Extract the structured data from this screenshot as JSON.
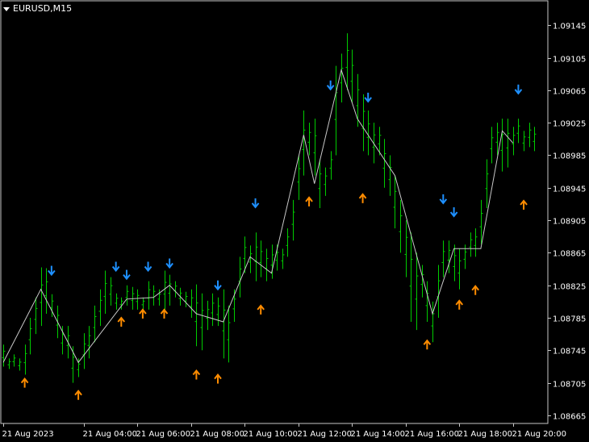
{
  "window": {
    "title": "EURUSD,M15"
  },
  "colors": {
    "background": "#000000",
    "frame": "#c8c8c8",
    "axis_text": "#ffffff",
    "bars": "#00cc00",
    "line": "#c8c8c8",
    "down_arrow": "#1e90ff",
    "up_arrow": "#ff8c00"
  },
  "icons": {
    "sell_signal": "down-arrow-icon",
    "buy_signal": "up-arrow-icon",
    "menu": "triangle-down-icon"
  },
  "chart_data": {
    "type": "line",
    "chart_kind": "ohlc-bars",
    "symbol": "EURUSD",
    "timeframe": "M15",
    "ylim": [
      1.08655,
      1.09175
    ],
    "y_ticks": [
      1.09145,
      1.09105,
      1.09065,
      1.09025,
      1.08985,
      1.08945,
      1.08905,
      1.08865,
      1.08825,
      1.08785,
      1.08745,
      1.08705,
      1.08665
    ],
    "x_ticks": [
      "21 Aug 2023",
      "21 Aug 04:00",
      "21 Aug 06:00",
      "21 Aug 08:00",
      "21 Aug 10:00",
      "21 Aug 12:00",
      "21 Aug 14:00",
      "21 Aug 16:00",
      "21 Aug 18:00",
      "21 Aug 20:00"
    ],
    "x_tick_index": [
      0,
      15,
      25,
      35,
      45,
      55,
      65,
      75,
      85,
      95
    ],
    "bar_count": 100,
    "bars": [
      {
        "h": 1.08752,
        "l": 1.08725
      },
      {
        "h": 1.08735,
        "l": 1.08722
      },
      {
        "h": 1.0874,
        "l": 1.08725
      },
      {
        "h": 1.08735,
        "l": 1.0872
      },
      {
        "h": 1.08752,
        "l": 1.08715
      },
      {
        "h": 1.08785,
        "l": 1.0874
      },
      {
        "h": 1.0881,
        "l": 1.08765
      },
      {
        "h": 1.08847,
        "l": 1.08775
      },
      {
        "h": 1.08846,
        "l": 1.0879
      },
      {
        "h": 1.08814,
        "l": 1.08786
      },
      {
        "h": 1.088,
        "l": 1.0876
      },
      {
        "h": 1.08775,
        "l": 1.0874
      },
      {
        "h": 1.08775,
        "l": 1.08735
      },
      {
        "h": 1.0875,
        "l": 1.08705
      },
      {
        "h": 1.08735,
        "l": 1.08712
      },
      {
        "h": 1.08766,
        "l": 1.08722
      },
      {
        "h": 1.08775,
        "l": 1.08735
      },
      {
        "h": 1.088,
        "l": 1.08755
      },
      {
        "h": 1.0882,
        "l": 1.08775
      },
      {
        "h": 1.08843,
        "l": 1.0879
      },
      {
        "h": 1.08835,
        "l": 1.088
      },
      {
        "h": 1.08815,
        "l": 1.08795
      },
      {
        "h": 1.0881,
        "l": 1.08795
      },
      {
        "h": 1.08825,
        "l": 1.088
      },
      {
        "h": 1.08823,
        "l": 1.08795
      },
      {
        "h": 1.0882,
        "l": 1.08795
      },
      {
        "h": 1.0881,
        "l": 1.08795
      },
      {
        "h": 1.0883,
        "l": 1.08795
      },
      {
        "h": 1.08825,
        "l": 1.088
      },
      {
        "h": 1.0882,
        "l": 1.088
      },
      {
        "h": 1.08843,
        "l": 1.08795
      },
      {
        "h": 1.08838,
        "l": 1.088
      },
      {
        "h": 1.0883,
        "l": 1.0881
      },
      {
        "h": 1.08822,
        "l": 1.088
      },
      {
        "h": 1.08817,
        "l": 1.08798
      },
      {
        "h": 1.0882,
        "l": 1.08785
      },
      {
        "h": 1.08826,
        "l": 1.0875
      },
      {
        "h": 1.08815,
        "l": 1.08745
      },
      {
        "h": 1.08806,
        "l": 1.0877
      },
      {
        "h": 1.08815,
        "l": 1.08775
      },
      {
        "h": 1.0881,
        "l": 1.08775
      },
      {
        "h": 1.0882,
        "l": 1.08735
      },
      {
        "h": 1.088,
        "l": 1.0873
      },
      {
        "h": 1.0882,
        "l": 1.0878
      },
      {
        "h": 1.0886,
        "l": 1.0881
      },
      {
        "h": 1.08885,
        "l": 1.0884
      },
      {
        "h": 1.08874,
        "l": 1.0884
      },
      {
        "h": 1.0889,
        "l": 1.0883
      },
      {
        "h": 1.0888,
        "l": 1.08835
      },
      {
        "h": 1.0887,
        "l": 1.0883
      },
      {
        "h": 1.08875,
        "l": 1.08833
      },
      {
        "h": 1.08875,
        "l": 1.08843
      },
      {
        "h": 1.0887,
        "l": 1.08845
      },
      {
        "h": 1.08895,
        "l": 1.0886
      },
      {
        "h": 1.0893,
        "l": 1.0888
      },
      {
        "h": 1.08985,
        "l": 1.0893
      },
      {
        "h": 1.0904,
        "l": 1.0896
      },
      {
        "h": 1.09025,
        "l": 1.08985
      },
      {
        "h": 1.0903,
        "l": 1.0896
      },
      {
        "h": 1.0898,
        "l": 1.0892
      },
      {
        "h": 1.0897,
        "l": 1.08935
      },
      {
        "h": 1.0899,
        "l": 1.08955
      },
      {
        "h": 1.09095,
        "l": 1.08985
      },
      {
        "h": 1.0911,
        "l": 1.0905
      },
      {
        "h": 1.09135,
        "l": 1.09065
      },
      {
        "h": 1.09115,
        "l": 1.0905
      },
      {
        "h": 1.09085,
        "l": 1.0902
      },
      {
        "h": 1.0906,
        "l": 1.0899
      },
      {
        "h": 1.0904,
        "l": 1.08985
      },
      {
        "h": 1.09025,
        "l": 1.08975
      },
      {
        "h": 1.0902,
        "l": 1.08985
      },
      {
        "h": 1.09005,
        "l": 1.08945
      },
      {
        "h": 1.08985,
        "l": 1.08935
      },
      {
        "h": 1.0896,
        "l": 1.08895
      },
      {
        "h": 1.0893,
        "l": 1.08865
      },
      {
        "h": 1.08905,
        "l": 1.08835
      },
      {
        "h": 1.0889,
        "l": 1.0878
      },
      {
        "h": 1.08865,
        "l": 1.0877
      },
      {
        "h": 1.0885,
        "l": 1.0881
      },
      {
        "h": 1.0883,
        "l": 1.0878
      },
      {
        "h": 1.08805,
        "l": 1.08755
      },
      {
        "h": 1.0885,
        "l": 1.08785
      },
      {
        "h": 1.0888,
        "l": 1.08835
      },
      {
        "h": 1.0888,
        "l": 1.0884
      },
      {
        "h": 1.08875,
        "l": 1.0883
      },
      {
        "h": 1.0887,
        "l": 1.0882
      },
      {
        "h": 1.08875,
        "l": 1.08845
      },
      {
        "h": 1.0889,
        "l": 1.0886
      },
      {
        "h": 1.08895,
        "l": 1.0886
      },
      {
        "h": 1.0893,
        "l": 1.08875
      },
      {
        "h": 1.0898,
        "l": 1.0892
      },
      {
        "h": 1.0902,
        "l": 1.08975
      },
      {
        "h": 1.09025,
        "l": 1.08985
      },
      {
        "h": 1.0903,
        "l": 1.08965
      },
      {
        "h": 1.0903,
        "l": 1.0897
      },
      {
        "h": 1.0902,
        "l": 1.08985
      },
      {
        "h": 1.0903,
        "l": 1.09
      },
      {
        "h": 1.09015,
        "l": 1.0899
      },
      {
        "h": 1.09025,
        "l": 1.08995
      },
      {
        "h": 1.0902,
        "l": 1.0899
      }
    ],
    "zigzag": [
      [
        0,
        1.0873
      ],
      [
        7,
        1.0882
      ],
      [
        14,
        1.0873
      ],
      [
        23,
        1.08808
      ],
      [
        28,
        1.0881
      ],
      [
        31,
        1.08825
      ],
      [
        36,
        1.0879
      ],
      [
        41,
        1.0878
      ],
      [
        46,
        1.0886
      ],
      [
        50,
        1.0884
      ],
      [
        56,
        1.0901
      ],
      [
        58,
        1.0895
      ],
      [
        63,
        1.0909
      ],
      [
        66,
        1.0903
      ],
      [
        73,
        1.0896
      ],
      [
        80,
        1.0879
      ],
      [
        84,
        1.0887
      ],
      [
        89,
        1.0887
      ],
      [
        93,
        1.09015
      ],
      [
        95,
        1.09
      ]
    ],
    "sell_signals": [
      9,
      21,
      23,
      27,
      31,
      40,
      47,
      61,
      68,
      82,
      84,
      96
    ],
    "buy_signals": [
      4,
      14,
      22,
      26,
      30,
      36,
      40,
      48,
      57,
      67,
      79,
      85,
      88,
      97
    ],
    "sell_price": [
      1.08843,
      1.08848,
      1.08838,
      1.08848,
      1.08852,
      1.08825,
      1.08926,
      1.09071,
      1.09056,
      1.08931,
      1.08915,
      1.09066
    ],
    "buy_price": [
      1.08705,
      1.0869,
      1.0878,
      1.0879,
      1.0879,
      1.08715,
      1.0871,
      1.08795,
      1.08928,
      1.08932,
      1.08752,
      1.08801,
      1.08819,
      1.08924
    ]
  }
}
